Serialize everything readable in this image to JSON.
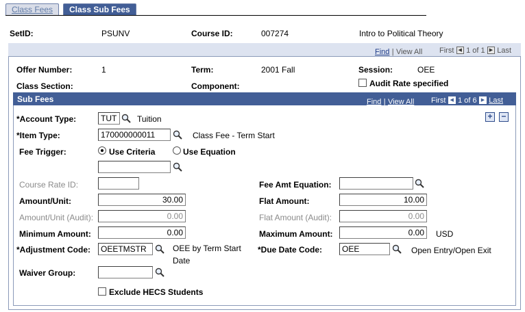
{
  "tabs": [
    {
      "label": "Class Fees",
      "active": false
    },
    {
      "label": "Class Sub Fees",
      "active": true
    }
  ],
  "header": {
    "setid_label": "SetID:",
    "setid_value": "PSUNV",
    "course_id_label": "Course ID:",
    "course_id_value": "007274",
    "course_title": "Intro to Political Theory"
  },
  "outer_nav": {
    "find": "Find",
    "sep": "|",
    "view_all": "View All",
    "first": "First",
    "count": "1 of 1",
    "last": "Last"
  },
  "offer": {
    "offer_number_label": "Offer Number:",
    "offer_number_value": "1",
    "term_label": "Term:",
    "term_value": "2001 Fall",
    "session_label": "Session:",
    "session_value": "OEE",
    "class_section_label": "Class Section:",
    "component_label": "Component:",
    "audit_rate_label": "Audit Rate specified"
  },
  "subfees": {
    "title": "Sub Fees",
    "nav": {
      "find": "Find",
      "sep": "|",
      "view_all": "View All",
      "first": "First",
      "count": "1 of 6",
      "last": "Last"
    },
    "account_type_label": "*Account Type:",
    "account_type_value": "TUT",
    "account_type_desc": "Tuition",
    "item_type_label": "*Item Type:",
    "item_type_value": "170000000011",
    "item_type_desc": "Class Fee - Term Start",
    "fee_trigger_label": "Fee Trigger:",
    "use_criteria_label": "Use Criteria",
    "use_equation_label": "Use Equation",
    "criteria_value": "",
    "course_rate_id_label": "Course Rate ID:",
    "course_rate_id_value": "",
    "fee_amt_equation_label": "Fee Amt Equation:",
    "fee_amt_equation_value": "",
    "amount_unit_label": "Amount/Unit:",
    "amount_unit_value": "30.00",
    "flat_amount_label": "Flat Amount:",
    "flat_amount_value": "10.00",
    "amount_unit_audit_label": "Amount/Unit (Audit):",
    "amount_unit_audit_value": "0.00",
    "flat_amount_audit_label": "Flat Amount (Audit):",
    "flat_amount_audit_value": "0.00",
    "minimum_amount_label": "Minimum Amount:",
    "minimum_amount_value": "0.00",
    "maximum_amount_label": "Maximum Amount:",
    "maximum_amount_value": "0.00",
    "currency": "USD",
    "adjustment_code_label": "*Adjustment Code:",
    "adjustment_code_value": "OEETMSTR",
    "adjustment_desc_line1": "OEE by Term Start",
    "adjustment_desc_line2": "Date",
    "due_date_code_label": "*Due Date Code:",
    "due_date_code_value": "OEE",
    "due_date_desc": "Open Entry/Open Exit",
    "waiver_group_label": "Waiver Group:",
    "waiver_group_value": "",
    "exclude_hecs_label": "Exclude HECS Students",
    "add_row": "+",
    "delete_row": "−"
  },
  "colors": {
    "tab_active": "#425e96",
    "section_header": "#425e96",
    "link": "#1d3a86"
  }
}
